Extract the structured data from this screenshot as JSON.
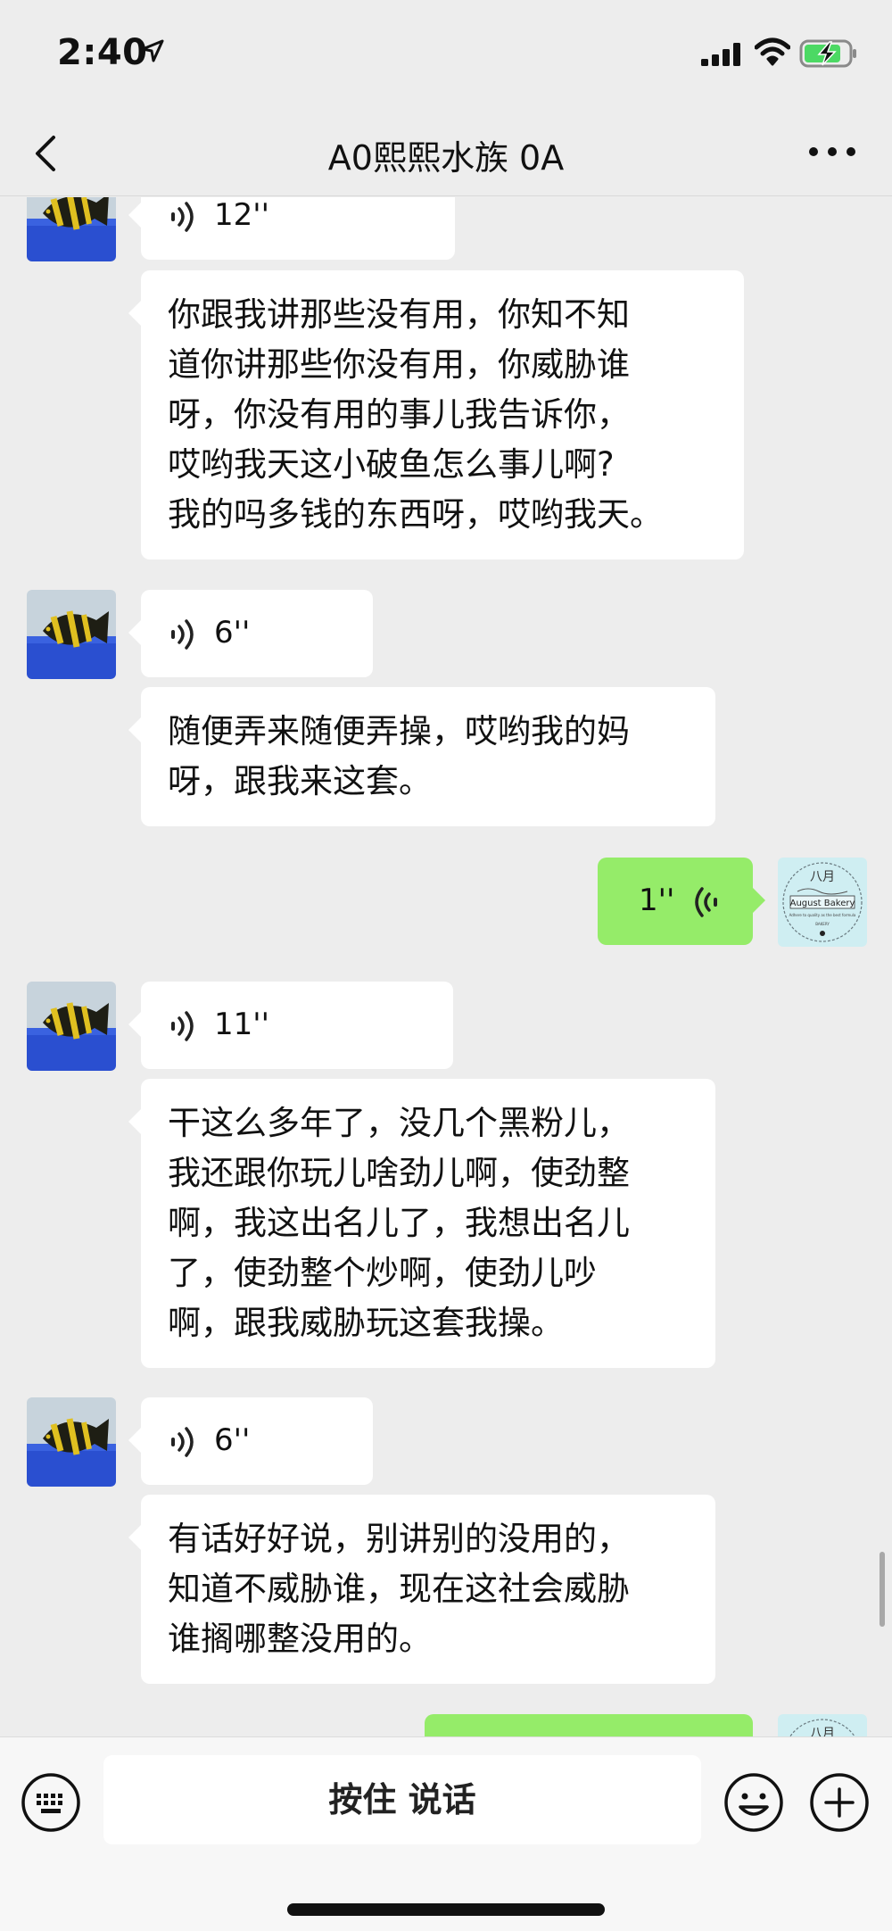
{
  "status_bar": {
    "time": "2:40",
    "icons": [
      "location-arrow-icon",
      "signal-icon",
      "wifi-icon",
      "battery-charging-icon"
    ]
  },
  "nav": {
    "title": "A0熙熙水族 0A",
    "icons": [
      "back-chevron-icon",
      "more-dots-icon"
    ]
  },
  "messages": [
    {
      "side": "left",
      "kind": "voice",
      "duration": "12''"
    },
    {
      "side": "left",
      "kind": "text",
      "text": "你跟我讲那些没有用，你知不知\n道你讲那些你没有用，你威胁谁\n呀，你没有用的事儿我告诉你，\n哎哟我天这小破鱼怎么事儿啊?\n我的吗多钱的东西呀，哎哟我天。"
    },
    {
      "side": "left",
      "kind": "voice",
      "duration": "6''"
    },
    {
      "side": "left",
      "kind": "text",
      "text": "随便弄来随便弄操，哎哟我的妈\n呀，跟我来这套。"
    },
    {
      "side": "right",
      "kind": "voice",
      "duration": "1''"
    },
    {
      "side": "left",
      "kind": "voice",
      "duration": "11''"
    },
    {
      "side": "left",
      "kind": "text",
      "text": "干这么多年了，没几个黑粉儿，\n我还跟你玩儿啥劲儿啊，使劲整\n啊，我这出名儿了，我想出名儿\n了，使劲整个炒啊，使劲儿吵\n啊，跟我威胁玩这套我操。"
    },
    {
      "side": "left",
      "kind": "voice",
      "duration": "6''"
    },
    {
      "side": "left",
      "kind": "text",
      "text": "有话好好说，别讲别的没用的，\n知道不威胁谁，现在这社会威胁\n谁搁哪整没用的。"
    }
  ],
  "my_avatar": {
    "top_text": "八月",
    "mid_text": "August Bakery",
    "small_text": "Adhere to quality as the best formula",
    "bottom_text": "BAKERY"
  },
  "input_bar": {
    "hold_to_talk": "按住 说话",
    "icons": [
      "keyboard-icon",
      "emoji-icon",
      "plus-icon"
    ]
  },
  "colors": {
    "background": "#ededed",
    "incoming_bubble": "#ffffff",
    "outgoing_bubble": "#95ec69",
    "avatar_water": "#2a4fd0"
  }
}
